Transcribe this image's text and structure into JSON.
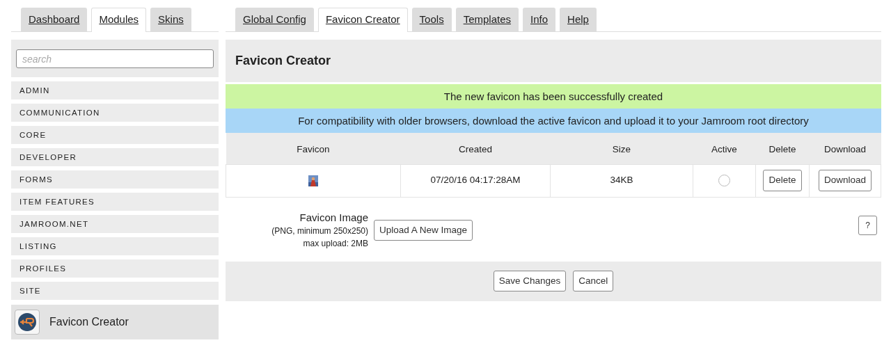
{
  "left_tabs": [
    {
      "label": "Dashboard",
      "selected": false
    },
    {
      "label": "Modules",
      "selected": true
    },
    {
      "label": "Skins",
      "selected": false
    }
  ],
  "right_tabs": [
    {
      "label": "Global Config",
      "selected": false
    },
    {
      "label": "Favicon Creator",
      "selected": true
    },
    {
      "label": "Tools",
      "selected": false
    },
    {
      "label": "Templates",
      "selected": false
    },
    {
      "label": "Info",
      "selected": false
    },
    {
      "label": "Help",
      "selected": false
    }
  ],
  "sidebar": {
    "search": {
      "placeholder": "search"
    },
    "categories": [
      "ADMIN",
      "COMMUNICATION",
      "CORE",
      "DEVELOPER",
      "FORMS",
      "ITEM FEATURES",
      "JAMROOM.NET",
      "LISTING",
      "PROFILES",
      "SITE"
    ],
    "modules": [
      {
        "label": "Favicon Creator",
        "selected": true
      }
    ]
  },
  "page_title": "Favicon Creator",
  "notices": [
    {
      "kind": "success",
      "text": "The new favicon has been successfully created"
    },
    {
      "kind": "info",
      "text": "For compatibility with older browsers, download the active favicon and upload it to your Jamroom root directory"
    }
  ],
  "table": {
    "columns": [
      "Favicon",
      "Created",
      "Size",
      "Active",
      "Delete",
      "Download"
    ],
    "rows": [
      {
        "created": "07/20/16 04:17:28AM",
        "size": "34KB",
        "active": false,
        "delete": "Delete",
        "download": "Download"
      }
    ]
  },
  "form": {
    "label": "Favicon Image",
    "hints": [
      "(PNG, minimum 250x250)",
      "max upload: 2MB"
    ],
    "button": "Upload A New Image",
    "help": "?"
  },
  "footer_buttons": [
    "Save Changes",
    "Cancel"
  ]
}
